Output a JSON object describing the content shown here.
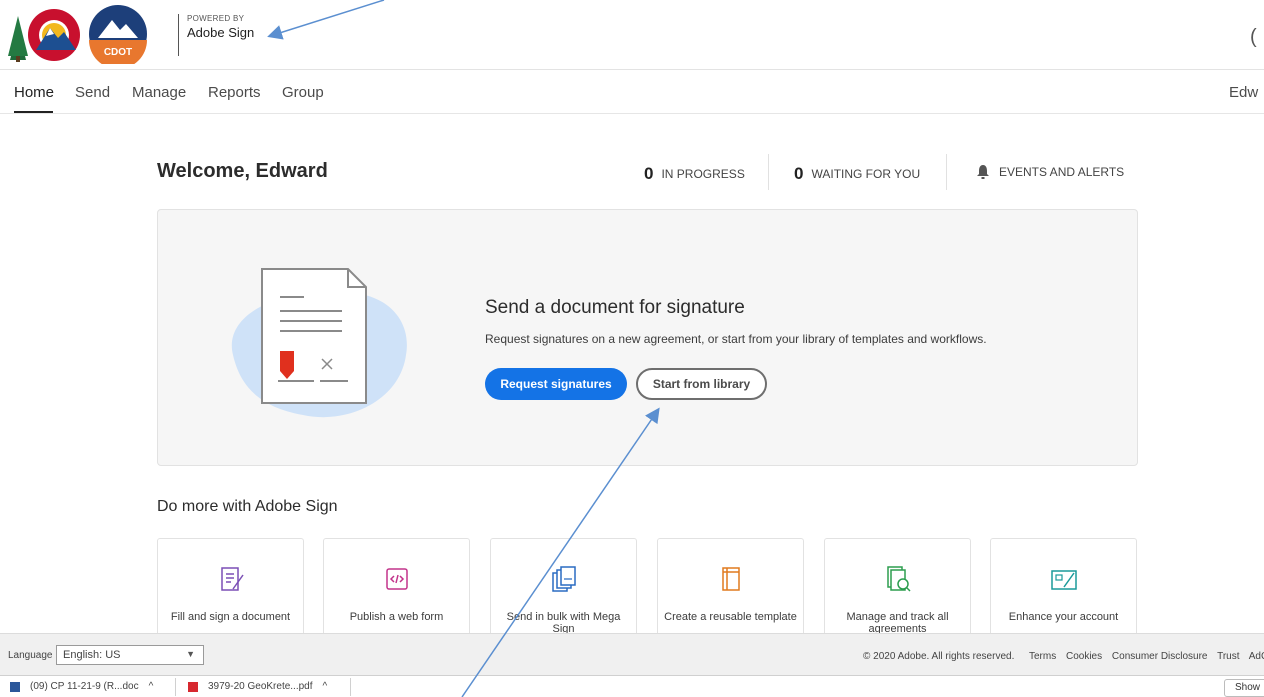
{
  "header": {
    "powered_small": "POWERED BY",
    "powered_brand": "Adobe Sign",
    "cdot_logo_text": "CDOT",
    "right_glyph": "("
  },
  "nav": {
    "items": [
      {
        "label": "Home"
      },
      {
        "label": "Send"
      },
      {
        "label": "Manage"
      },
      {
        "label": "Reports"
      },
      {
        "label": "Group"
      }
    ],
    "user": "Edw"
  },
  "welcome": {
    "title": "Welcome, Edward",
    "in_progress_count": "0",
    "in_progress_label": "IN PROGRESS",
    "waiting_count": "0",
    "waiting_label": "WAITING FOR YOU",
    "events_label": "EVENTS AND ALERTS"
  },
  "hero": {
    "title": "Send a document for signature",
    "subtitle": "Request signatures on a new agreement, or start from your library of templates and workflows.",
    "primary_button": "Request signatures",
    "secondary_button": "Start from library"
  },
  "do_more": {
    "title": "Do more with Adobe Sign",
    "tiles": [
      {
        "label": "Fill and sign a document",
        "icon": "fill-sign-icon"
      },
      {
        "label": "Publish a web form",
        "icon": "web-form-icon"
      },
      {
        "label": "Send in bulk with Mega Sign",
        "icon": "mega-sign-icon"
      },
      {
        "label": "Create a reusable template",
        "icon": "template-icon"
      },
      {
        "label": "Manage and track all agreements",
        "icon": "manage-track-icon"
      },
      {
        "label": "Enhance your account",
        "icon": "enhance-account-icon"
      }
    ]
  },
  "footer": {
    "language_label": "Language",
    "language_value": "English: US",
    "copyright": "© 2020 Adobe. All rights reserved.",
    "links": [
      "Terms",
      "Cookies",
      "Consumer Disclosure",
      "Trust",
      "AdC"
    ]
  },
  "downloads": {
    "items": [
      "(09) CP 11-21-9 (R...doc",
      "3979-20 GeoKrete...pdf"
    ],
    "show_all": "Show"
  },
  "colors": {
    "primary_button": "#1473e6",
    "hero_bg": "#f6f6f6",
    "annotation_arrow": "#5b8fd0"
  }
}
